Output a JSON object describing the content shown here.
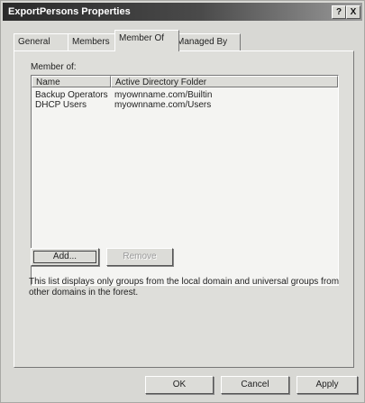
{
  "window": {
    "title": "ExportPersons Properties",
    "help_button": "?",
    "close_button": "X"
  },
  "tabs": [
    {
      "label": "General",
      "active": false
    },
    {
      "label": "Members",
      "active": false
    },
    {
      "label": "Member Of",
      "active": true
    },
    {
      "label": "Managed By",
      "active": false
    }
  ],
  "member_of": {
    "label": "Member of:",
    "columns": [
      "Name",
      "Active Directory Folder"
    ],
    "rows": [
      {
        "name": "Backup Operators",
        "folder": "myownname.com/Builtin"
      },
      {
        "name": "DHCP Users",
        "folder": "myownname.com/Users"
      }
    ],
    "add_label": "Add...",
    "remove_label": "Remove",
    "info_text": "This list displays only groups from the local domain and universal groups from other domains in the forest."
  },
  "footer": {
    "ok_label": "OK",
    "cancel_label": "Cancel",
    "apply_label": "Apply"
  }
}
